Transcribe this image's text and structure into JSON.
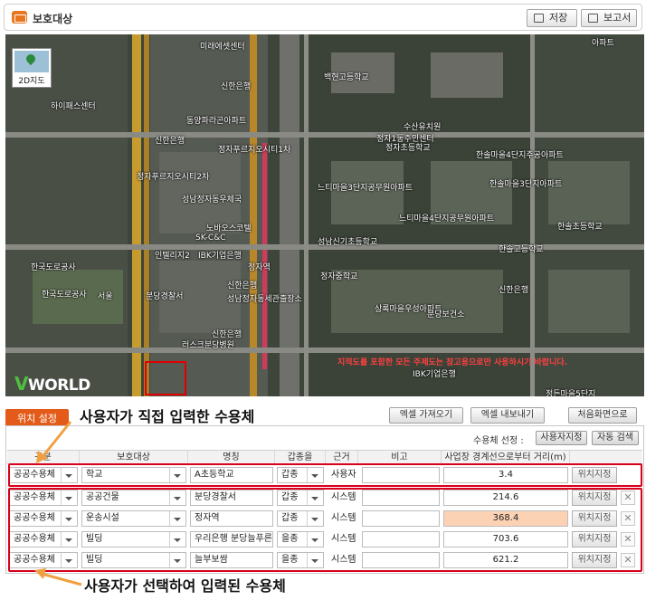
{
  "header": {
    "title": "보호대상",
    "save_label": "저장",
    "report_label": "보고서"
  },
  "map": {
    "view_toggle": "2D지도",
    "brand": "WORLD",
    "brand_v": "V",
    "notice": "지적도를 포함한 모든 주제도는 참고용으로만 사용하시기 바랍니다.",
    "labels": [
      "미래에셋센터",
      "신한은행",
      "하이패스센터",
      "동양파라곤아파트",
      "신한은행",
      "정자푸르지오시티2차",
      "정자푸르지오시티1차",
      "성남정자동우체국",
      "노바오스코텔",
      "SK-C&C",
      "인텔리지2",
      "IBK기업은행",
      "정자역",
      "분당경찰서",
      "신한은행",
      "성남정자동세관출장소",
      "러스크분당병원",
      "신한은행",
      "한국도로공사",
      "한국도로공사",
      "서울",
      "정자초등학교",
      "느티마을3단지공무원아파트",
      "느티마을4단지공무원아파트",
      "성남신기초등학교",
      "정자중학교",
      "상록마을우성아파트",
      "분당보건소",
      "신한은행",
      "IBK기업은행",
      "한솔초등학교",
      "한솔고등학교",
      "정든마을5단지",
      "아파트",
      "백현고등학교",
      "수산유치원",
      "정자1동주민센터",
      "한솔마을4단지주공아파트",
      "한솔마을3단지아파트"
    ]
  },
  "controls": {
    "location_tab": "위치 설정",
    "annotation_top": "사용자가 직접 입력한 수용체",
    "annotation_bottom": "사용자가 선택하여 입력된 수용체",
    "excel_import": "엑셀 가져오기",
    "excel_export": "엑셀 내보내기",
    "reset_button": "처음화면으로",
    "receptor_select_label": "수용체 선정 :",
    "user_designate": "사용자지정",
    "auto_search": "자동 검색"
  },
  "table": {
    "headers": [
      "구분",
      "보호대상",
      "명칭",
      "갑종을",
      "근거",
      "비고",
      "사업장 경계선으로부터 거리(m)"
    ],
    "location_button": "위치지정",
    "delete_symbol": "✕",
    "rows": [
      {
        "category": "공공수용체",
        "target": "학교",
        "name": "A초등학교",
        "grade": "갑종",
        "basis": "사용자",
        "note": "",
        "distance": "3.4",
        "highlight": false,
        "has_delete": false
      },
      {
        "category": "공공수용체",
        "target": "공공건물",
        "name": "분당경찰서",
        "grade": "갑종",
        "basis": "시스템",
        "note": "",
        "distance": "214.6",
        "highlight": false,
        "has_delete": true
      },
      {
        "category": "공공수용체",
        "target": "운송시설",
        "name": "정자역",
        "grade": "갑종",
        "basis": "시스템",
        "note": "",
        "distance": "368.4",
        "highlight": true,
        "has_delete": true
      },
      {
        "category": "공공수용체",
        "target": "빌딩",
        "name": "우리은행 분당늘푸른",
        "grade": "을종",
        "basis": "시스템",
        "note": "",
        "distance": "703.6",
        "highlight": false,
        "has_delete": true
      },
      {
        "category": "공공수용체",
        "target": "빌딩",
        "name": "늘부보쌈",
        "grade": "을종",
        "basis": "시스템",
        "note": "",
        "distance": "621.2",
        "highlight": false,
        "has_delete": true
      }
    ]
  },
  "colors": {
    "accent": "#e35a19",
    "highlight_box": "#d9001b",
    "row_highlight": "#fcd2b4"
  }
}
